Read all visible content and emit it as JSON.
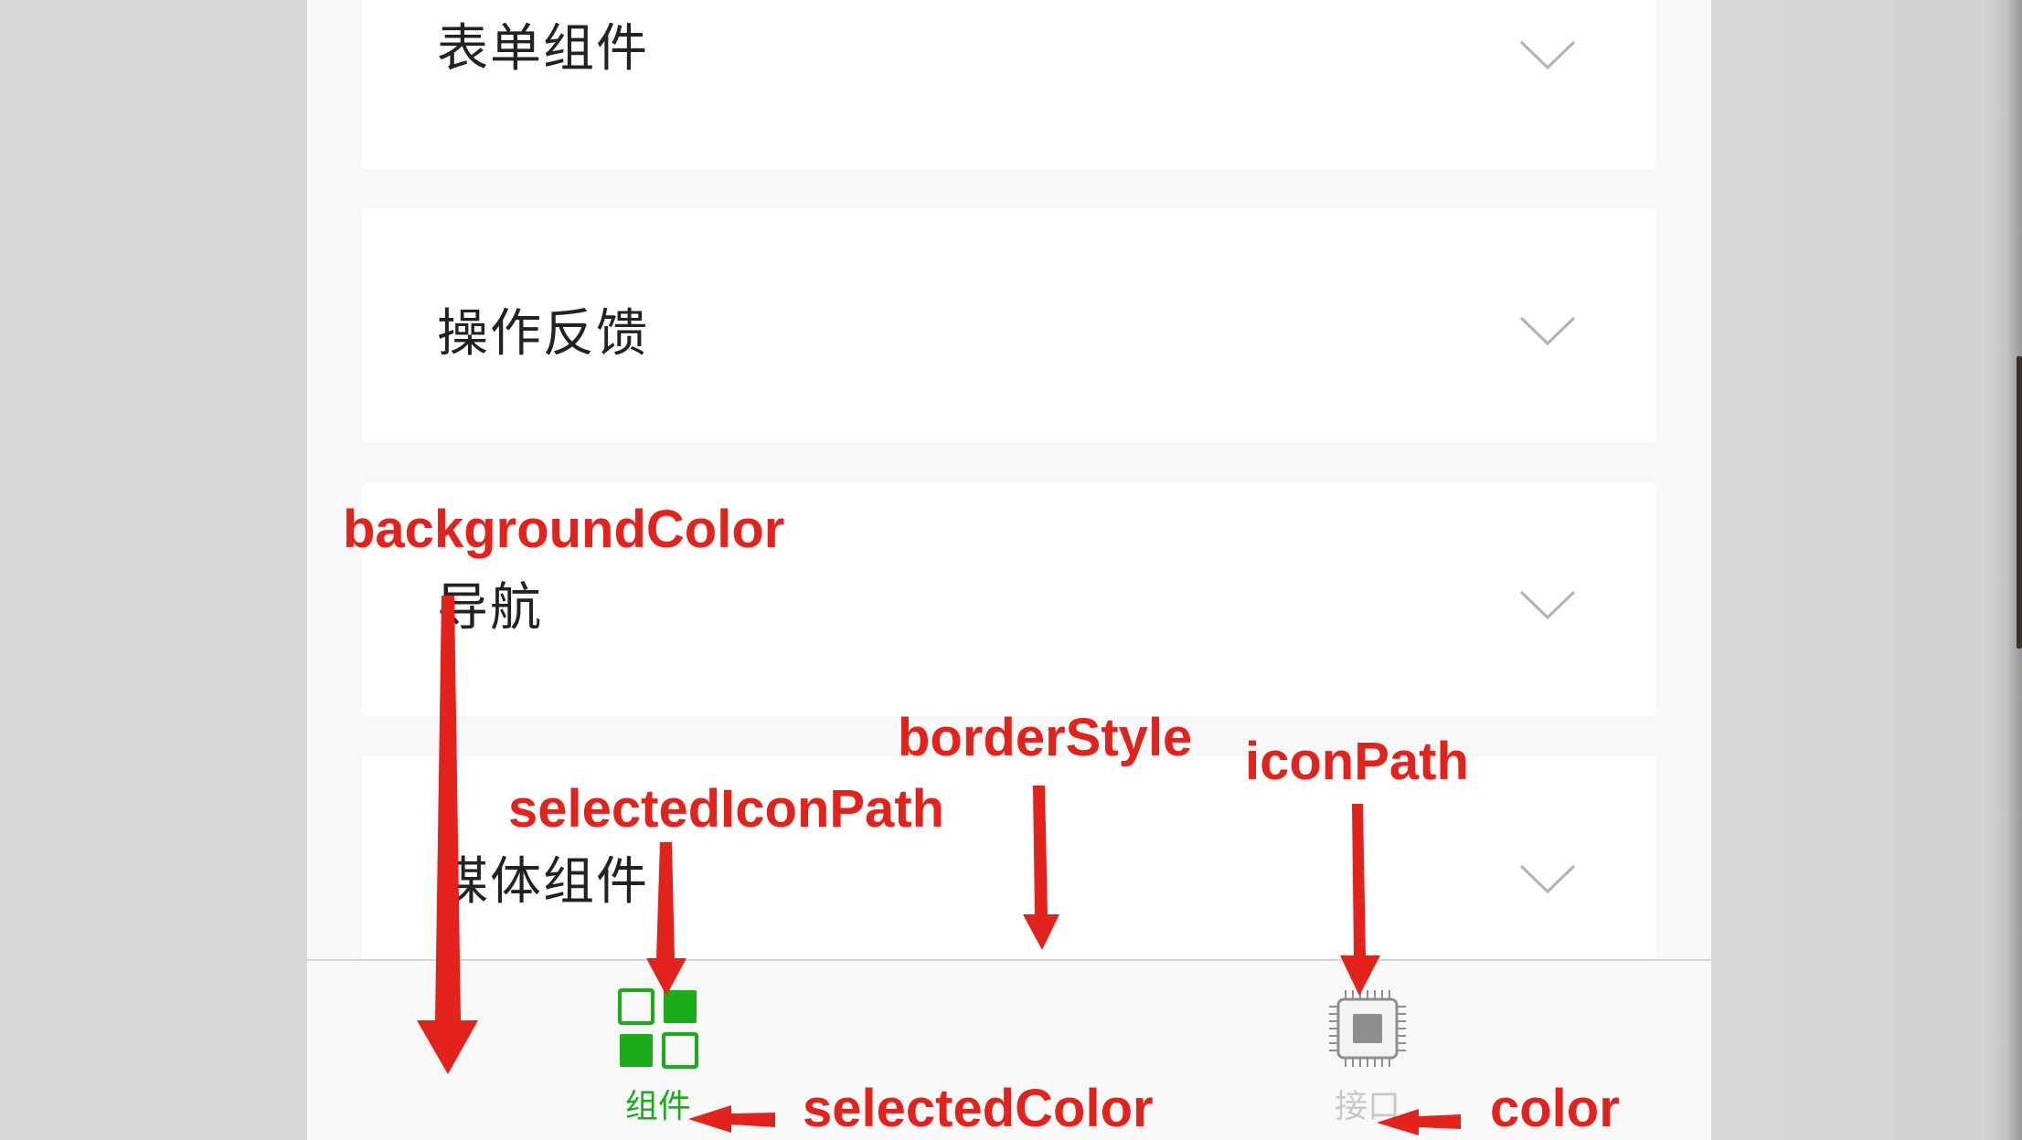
{
  "accordion": {
    "items": [
      {
        "label": "表单组件"
      },
      {
        "label": "操作反馈"
      },
      {
        "label": "导航"
      },
      {
        "label": "媒体组件"
      }
    ]
  },
  "tabbar": {
    "tabs": [
      {
        "label": "组件",
        "icon": "grid-icon",
        "selected": true
      },
      {
        "label": "接口",
        "icon": "chip-icon",
        "selected": false
      }
    ]
  },
  "annotations": {
    "background_color": "backgroundColor",
    "border_style": "borderStyle",
    "icon_path": "iconPath",
    "selected_icon_path": "selectedIconPath",
    "selected_color": "selectedColor",
    "color": "color"
  },
  "colors": {
    "selected": "#1aad19",
    "unselected": "#c8c8c8",
    "annotation": "#e2221b"
  }
}
